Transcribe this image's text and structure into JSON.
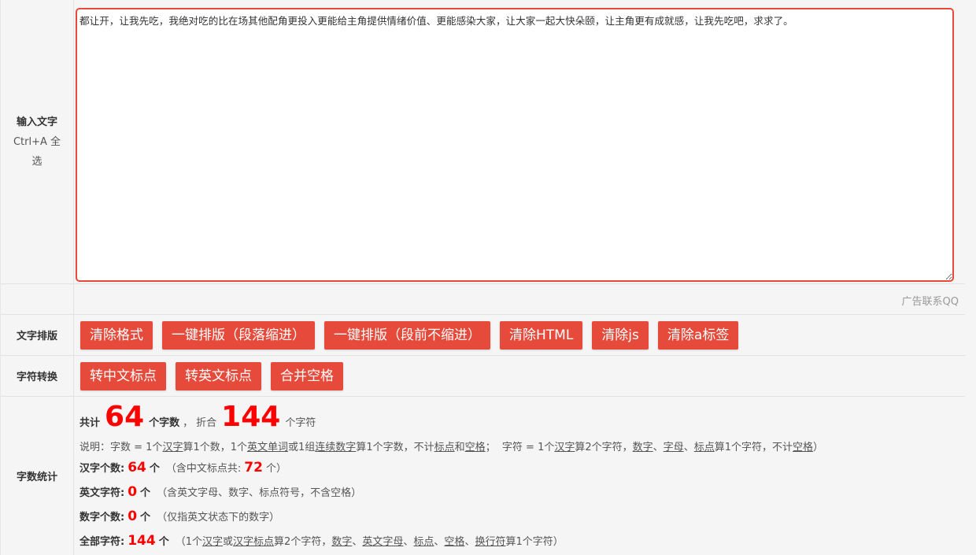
{
  "input": {
    "label": "输入文字",
    "hint1": "Ctrl+A 全",
    "hint2": "选",
    "text": "都让开，让我先吃，我绝对吃的比在场其他配角更投入更能给主角提供情绪价值、更能感染大家，让大家一起大快朵颐，让主角更有成就感，让我先吃吧，求求了。"
  },
  "ad": {
    "text": "广告联系QQ"
  },
  "typeset": {
    "label": "文字排版",
    "buttons": [
      "清除格式",
      "一键排版（段落缩进）",
      "一键排版（段前不缩进）",
      "清除HTML",
      "清除js",
      "清除a标签"
    ]
  },
  "convert": {
    "label": "字符转换",
    "buttons": [
      "转中文标点",
      "转英文标点",
      "合并空格"
    ]
  },
  "stats": {
    "label": "字数统计",
    "total_prefix": "共计",
    "word_count": "64",
    "word_unit": "个字数",
    "comma": "，",
    "equal": "折合",
    "char_count": "144",
    "char_unit": "个字符",
    "desc": {
      "p1": "说明：字数 = 1个",
      "hz": "汉字",
      "p2": "算1个数，1个",
      "en": "英文单词",
      "p3": "或1组",
      "num": "连续数字",
      "p4": "算1个字数，不计",
      "bd": "标点",
      "p5": "和",
      "kg": "空格",
      "p6": "；  字符 = 1个",
      "hz2": "汉字",
      "p7": "算2个字符，",
      "sz": "数字",
      "p8": "、",
      "zm": "字母",
      "p9": "、",
      "bd2": "标点",
      "p10": "算1个字符，不计",
      "kg2": "空格",
      "p11": "）"
    },
    "han": {
      "label": "汉字个数:",
      "value": "64",
      "unit": "个",
      "note_a": "（含中文标点共:",
      "note_val": "72",
      "note_b": "个）"
    },
    "eng": {
      "label": "英文字符:",
      "value": "0",
      "unit": "个",
      "note": "（含英文字母、数字、标点符号，不含空格）"
    },
    "digit": {
      "label": "数字个数:",
      "value": "0",
      "unit": "个",
      "note": "（仅指英文状态下的数字）"
    },
    "all": {
      "label": "全部字符:",
      "value": "144",
      "unit": "个",
      "n1": "（1个",
      "hz": "汉字",
      "n2": "或",
      "hzbd": "汉字标点",
      "n3": "算2个字符，",
      "sz": "数字",
      "n4": "、",
      "zm": "英文字母",
      "n5": "、",
      "bd": "标点",
      "n6": "、",
      "kg": "空格",
      "n7": "、",
      "hh": "换行符",
      "n8": "算1个字符）"
    }
  }
}
